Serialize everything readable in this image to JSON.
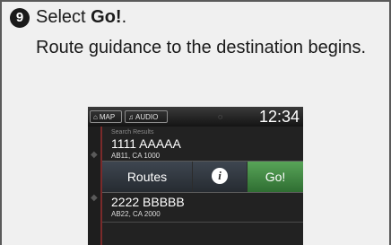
{
  "step": {
    "number": "9",
    "title_prefix": "Select ",
    "title_bold": "Go!",
    "title_suffix": ".",
    "description": "Route guidance to the destination begins."
  },
  "screen": {
    "status_bar": {
      "map_label": "MAP",
      "audio_label": "AUDIO",
      "time": "12:34"
    },
    "list_header": "Search Results",
    "results": [
      {
        "name": "1111 AAAAA",
        "address": "AB11, CA 1000"
      },
      {
        "name": "2222 BBBBB",
        "address": "AB22, CA 2000"
      }
    ],
    "actions": {
      "routes_label": "Routes",
      "go_label": "Go!"
    }
  }
}
